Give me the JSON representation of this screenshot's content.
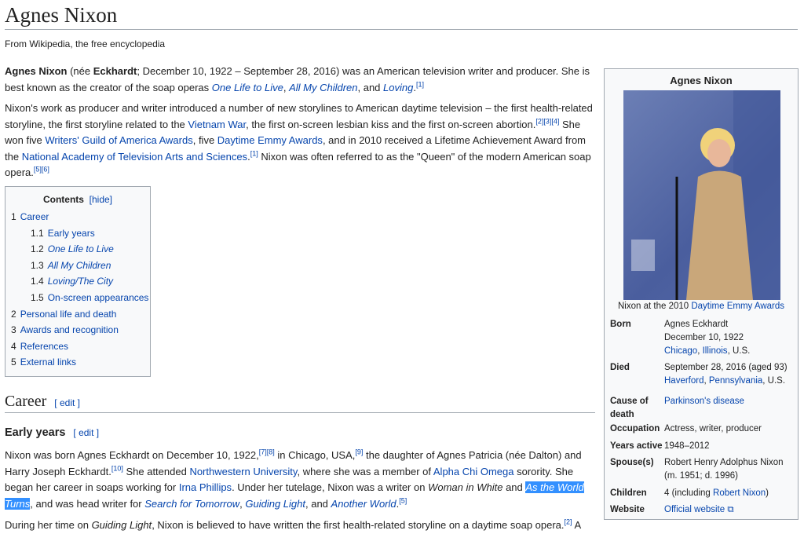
{
  "title": "Agnes Nixon",
  "subtitle": "From Wikipedia, the free encyclopedia",
  "paragraphs": [
    [
      {
        "t": "Agnes Nixon",
        "b": 1
      },
      {
        "t": " (née "
      },
      {
        "t": "Eckhardt",
        "b": 1
      },
      {
        "t": "; December 10, 1922 – September 28, 2016) was an American television writer and producer. She is best known as the creator of the soap operas "
      },
      {
        "t": "One Life to Live",
        "l": 1,
        "i": 1
      },
      {
        "t": ", "
      },
      {
        "t": "All My Children",
        "l": 1,
        "i": 1
      },
      {
        "t": ", and "
      },
      {
        "t": "Loving",
        "l": 1,
        "i": 1
      },
      {
        "t": "."
      },
      {
        "t": "[1]",
        "s": 1
      }
    ],
    [
      {
        "t": "Nixon's work as producer and writer introduced a number of new storylines to American daytime television – the first health-related storyline, the first storyline related to the "
      },
      {
        "t": "Vietnam War",
        "l": 1
      },
      {
        "t": ", the first on-screen lesbian kiss and the first on-screen abortion."
      },
      {
        "t": "[2][3][4]",
        "s": 1
      },
      {
        "t": " She won five "
      },
      {
        "t": "Writers' Guild of America Awards",
        "l": 1
      },
      {
        "t": ", five "
      },
      {
        "t": "Daytime Emmy Awards",
        "l": 1
      },
      {
        "t": ", and in 2010 received a Lifetime Achievement Award from the "
      },
      {
        "t": "National Academy of Television Arts and Sciences",
        "l": 1
      },
      {
        "t": "."
      },
      {
        "t": "[1]",
        "s": 1
      },
      {
        "t": " Nixon was often referred to as the \"Queen\" of the modern American soap opera."
      },
      {
        "t": "[5][6]",
        "s": 1
      }
    ],
    [
      {
        "t": "Nixon was born Agnes Eckhardt on December 10, 1922,"
      },
      {
        "t": "[7][8]",
        "s": 1
      },
      {
        "t": " in Chicago, USA,"
      },
      {
        "t": "[9]",
        "s": 1
      },
      {
        "t": " the daughter of Agnes Patricia (née Dalton) and Harry Joseph Eckhardt."
      },
      {
        "t": "[10]",
        "s": 1
      },
      {
        "t": " She attended "
      },
      {
        "t": "Northwestern University",
        "l": 1
      },
      {
        "t": ", where she was a member of "
      },
      {
        "t": "Alpha Chi Omega",
        "l": 1
      },
      {
        "t": " sorority. She began her career in soaps working for "
      },
      {
        "t": "Irna Phillips",
        "l": 1
      },
      {
        "t": ". Under her tutelage, Nixon was a writer on "
      },
      {
        "t": "Woman in White",
        "i": 1
      },
      {
        "t": " and "
      },
      {
        "t": "As the World Turns",
        "l": 1,
        "i": 1,
        "sel": 1
      },
      {
        "t": ", and was head writer for "
      },
      {
        "t": "Search for Tomorrow",
        "l": 1,
        "i": 1
      },
      {
        "t": ", "
      },
      {
        "t": "Guiding Light",
        "l": 1,
        "i": 1
      },
      {
        "t": ", and "
      },
      {
        "t": "Another World",
        "l": 1,
        "i": 1
      },
      {
        "t": "."
      },
      {
        "t": "[5]",
        "s": 1
      }
    ],
    [
      {
        "t": "During her time on "
      },
      {
        "t": "Guiding Light",
        "i": 1
      },
      {
        "t": ", Nixon is believed to have written the first health-related storyline on a daytime soap opera."
      },
      {
        "t": "[2]",
        "s": 1
      },
      {
        "t": " A"
      }
    ]
  ],
  "toc": {
    "title": "Contents",
    "hide": "[hide]",
    "items": [
      {
        "n": "1",
        "t": "Career"
      },
      {
        "n": "1.1",
        "t": "Early years",
        "sub": 1
      },
      {
        "n": "1.2",
        "t": "One Life to Live",
        "sub": 1,
        "i": 1
      },
      {
        "n": "1.3",
        "t": "All My Children",
        "sub": 1,
        "i": 1
      },
      {
        "n": "1.4",
        "t": "Loving/The City",
        "sub": 1,
        "i": 1
      },
      {
        "n": "1.5",
        "t": "On-screen appearances",
        "sub": 1
      },
      {
        "n": "2",
        "t": "Personal life and death"
      },
      {
        "n": "3",
        "t": "Awards and recognition"
      },
      {
        "n": "4",
        "t": "References"
      },
      {
        "n": "5",
        "t": "External links"
      }
    ]
  },
  "career": {
    "heading": "Career",
    "edit": "[ edit ]"
  },
  "early": {
    "heading": "Early years",
    "edit": "[ edit ]"
  },
  "infobox": {
    "title": "Agnes Nixon",
    "caption_pre": "Nixon at the 2010 ",
    "caption_link": "Daytime Emmy Awards",
    "rows": [
      {
        "k": "Born",
        "v": [
          [
            {
              "t": "Agnes Eckhardt"
            }
          ],
          [
            {
              "t": "December 10, 1922"
            }
          ],
          [
            {
              "t": "Chicago",
              "l": 1
            },
            {
              "t": ", "
            },
            {
              "t": "Illinois",
              "l": 1
            },
            {
              "t": ", U.S."
            }
          ]
        ]
      },
      {
        "k": "Died",
        "v": [
          [
            {
              "t": "September 28, 2016 (aged 93)"
            }
          ],
          [
            {
              "t": "Haverford",
              "l": 1
            },
            {
              "t": ", "
            },
            {
              "t": "Pennsylvania",
              "l": 1
            },
            {
              "t": ", U.S."
            }
          ]
        ]
      },
      {
        "k": "Cause of death",
        "v": [
          [
            {
              "t": "Parkinson's disease",
              "l": 1
            }
          ]
        ]
      },
      {
        "k": "Occupation",
        "v": [
          [
            {
              "t": "Actress, writer, producer"
            }
          ]
        ]
      },
      {
        "k": "Years active",
        "v": [
          [
            {
              "t": "1948–2012"
            }
          ]
        ]
      },
      {
        "k": "Spouse(s)",
        "v": [
          [
            {
              "t": "Robert Henry Adolphus Nixon"
            }
          ],
          [
            {
              "t": "(m. 1951; d. 1996)"
            }
          ]
        ]
      },
      {
        "k": "Children",
        "v": [
          [
            {
              "t": "4 (including "
            },
            {
              "t": "Robert Nixon",
              "l": 1
            },
            {
              "t": ")"
            }
          ]
        ]
      },
      {
        "k": "Website",
        "v": [
          [
            {
              "t": "Official website ⧉",
              "l": 1
            }
          ]
        ]
      }
    ]
  }
}
